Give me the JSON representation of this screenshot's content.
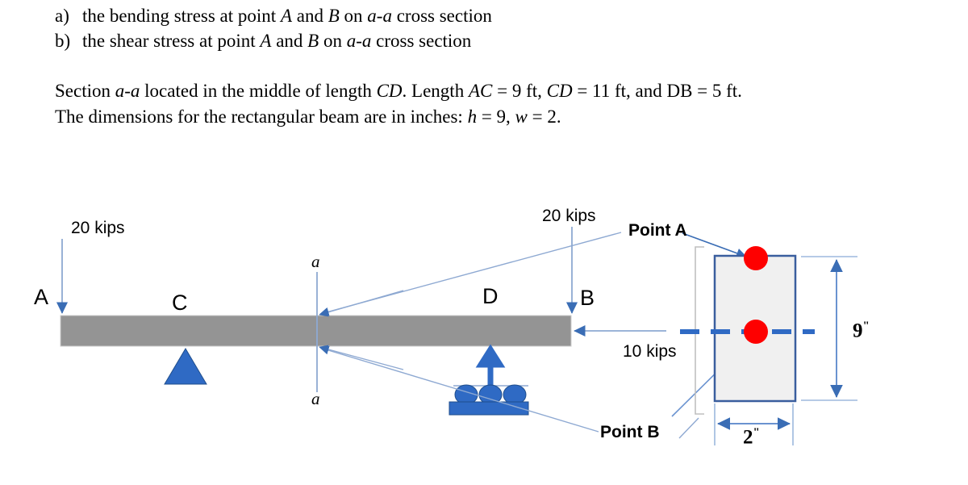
{
  "problem": {
    "items": [
      {
        "marker": "a)",
        "text_parts": [
          "the bending stress at point ",
          "A",
          " and ",
          "B",
          " on ",
          "a-a",
          " cross section"
        ]
      },
      {
        "marker": "b)",
        "text_parts": [
          "the shear stress at point ",
          "A",
          " and ",
          "B",
          " on ",
          "a-a",
          " cross section"
        ]
      }
    ],
    "paragraph_lines": [
      "Section a-a located in the middle of length CD. Length AC = 9 ft, CD = 11 ft, and DB = 5 ft.",
      "The dimensions for the rectangular beam are in inches: h = 9, w = 2."
    ],
    "given": {
      "AC": "9 ft",
      "CD": "11 ft",
      "DB": "5 ft",
      "h": "9",
      "w": "2",
      "units": "inches"
    }
  },
  "figure": {
    "beam": {
      "label": "beam"
    },
    "loads": [
      {
        "name": "load-at-A",
        "value": "20 kips",
        "direction": "down"
      },
      {
        "name": "load-at-D",
        "value": "20 kips",
        "direction": "down"
      },
      {
        "name": "load-at-B",
        "value": "10 kips",
        "direction": "left"
      }
    ],
    "nodes": [
      {
        "name": "A",
        "label": "A"
      },
      {
        "name": "C",
        "label": "C"
      },
      {
        "name": "D",
        "label": "D"
      },
      {
        "name": "B",
        "label": "B"
      }
    ],
    "section_marks": [
      {
        "label": "a",
        "position": "top"
      },
      {
        "label": "a",
        "position": "bottom"
      }
    ],
    "callouts": [
      {
        "label": "Point A",
        "target": "top-fiber"
      },
      {
        "label": "Point B",
        "target": "neutral-axis"
      }
    ],
    "cross_section": {
      "height_label": "9",
      "height_unit": "\"",
      "width_label": "2",
      "width_unit": "\"",
      "fill_color": "#f0f0f0",
      "stroke_color": "#3a5e9e",
      "point_color": "#fe0000",
      "neutral_axis_color": "#2f6ac4"
    },
    "colors": {
      "beam_fill": "#949494",
      "support_blue": "#2f6ac4",
      "leader_line": "#8ea9d2",
      "arrow_blue": "#3a6db5"
    }
  }
}
